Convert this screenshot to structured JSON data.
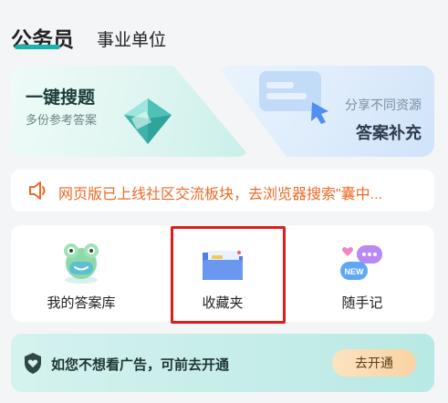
{
  "tabs": [
    {
      "label": "公务员",
      "active": true
    },
    {
      "label": "事业单位",
      "active": false
    }
  ],
  "accent_color": "#1bb1ad",
  "cards": {
    "search": {
      "title": "一键搜题",
      "subtitle": "多份参考答案",
      "icon": "gem-icon"
    },
    "share": {
      "title": "答案补充",
      "subtitle": "分享不同资源",
      "icon": "chat-cursor-icon"
    }
  },
  "notice": {
    "icon": "speaker-icon",
    "text": "网页版已上线社区交流板块，去浏览器搜索\"囊中...",
    "color": "#ec6a25"
  },
  "tools": [
    {
      "label": "我的答案库",
      "icon": "frog-icon"
    },
    {
      "label": "收藏夹",
      "icon": "folder-icon"
    },
    {
      "label": "随手记",
      "icon": "chat-bubbles-icon",
      "badge": "NEW"
    }
  ],
  "ad": {
    "text": "如您不想看广告，可前去开通",
    "button": "去开通",
    "icon": "shield-heart-icon"
  }
}
